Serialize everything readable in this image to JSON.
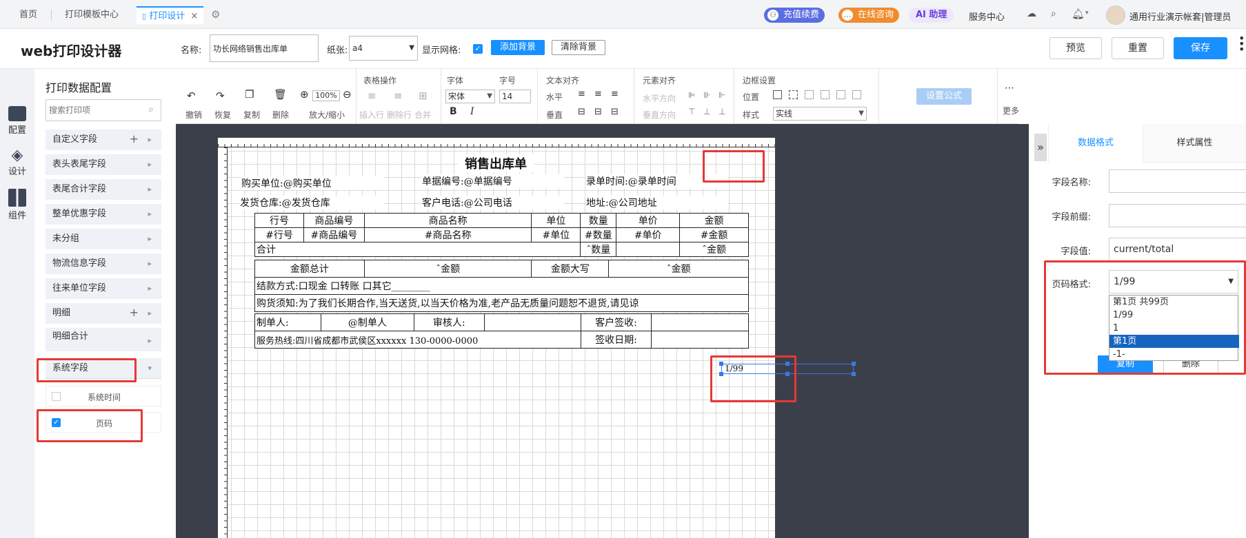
{
  "top_tabs": {
    "home": "首页",
    "template_center": "打印模板中心",
    "print_design": "打印设计",
    "close": "×"
  },
  "top_right": {
    "recharge": "充值续费",
    "consult": "在线咨询",
    "ai": "AI 助理",
    "service": "服务中心",
    "user": "通用行业演示帐套|管理员"
  },
  "header": {
    "title": "web打印设计器",
    "name_label": "名称:",
    "name_value": "功长网络销售出库单",
    "paper_label": "纸张:",
    "paper_value": "a4",
    "grid_label": "显示网格:",
    "add_bg": "添加背景",
    "clear_bg": "清除背景",
    "preview": "预览",
    "reset": "重置",
    "save": "保存"
  },
  "left_nav": {
    "config": "配置",
    "design": "设计",
    "components": "组件"
  },
  "data_config": {
    "title": "打印数据配置",
    "search_placeholder": "搜索打印项",
    "groups": [
      "自定义字段",
      "表头表尾字段",
      "表尾合计字段",
      "整单优惠字段",
      "未分组",
      "物流信息字段",
      "往来单位字段",
      "明细",
      "明细合计",
      "系统字段"
    ],
    "system_items": [
      {
        "label": "系统时间",
        "checked": false
      },
      {
        "label": "页码",
        "checked": true
      }
    ]
  },
  "toolbar": {
    "undo": "撤销",
    "redo": "恢复",
    "copy": "复制",
    "delete": "删除",
    "zoom_label": "放大/缩小",
    "zoom_value": "100%",
    "table_ops": "表格操作",
    "insert_row": "插入行",
    "delete_row": "删除行",
    "merge": "合并",
    "font": "字体",
    "font_value": "宋体",
    "font_size": "字号",
    "font_size_value": "14",
    "text_align": "文本对齐",
    "horizontal": "水平",
    "vertical": "垂直",
    "elem_align": "元素对齐",
    "h_dir": "水平方向",
    "v_dir": "垂直方向",
    "border": "边框设置",
    "position": "位置",
    "style": "样式",
    "style_value": "实线",
    "formula": "设置公式",
    "more": "更多"
  },
  "paper": {
    "title": "销售出库单",
    "fields": [
      {
        "text": "购买单位:@购买单位"
      },
      {
        "text": "单据编号:@单据编号"
      },
      {
        "text": "录单时间:@录单时间"
      },
      {
        "text": "发货仓库:@发货仓库"
      },
      {
        "text": "客户电话:@公司电话"
      },
      {
        "text": "地址:@公司地址"
      }
    ],
    "table": {
      "headers": [
        "行号",
        "商品编号",
        "商品名称",
        "单位",
        "数量",
        "单价",
        "金额"
      ],
      "row": [
        "#行号",
        "#商品编号",
        "#商品名称",
        "#单位",
        "#数量",
        "#单价",
        "#金额"
      ],
      "sum_label": "合计",
      "sum_qty": "ˆ数量",
      "sum_amt": "ˆ金额",
      "total_label": "金额总计",
      "total_value": "ˆ金额",
      "upper_label": "金额大写",
      "upper_value": "ˆ金额",
      "payment": "结款方式:口现金 口转账 口其它________",
      "notice": "购货须知:为了我们长期合作,当天送货,以当天价格为准,老产品无质量问题恕不退货,请见谅",
      "maker": "制单人:",
      "maker_value": "@制单人",
      "reviewer": "审核人:",
      "customer_sign": "客户签收:",
      "hotline": "服务热线:四川省成都市武侯区xxxxxx 130-0000-0000",
      "sign_date": "签收日期:"
    },
    "page_element": "1/99"
  },
  "right_panel": {
    "tab_data_format": "数据格式",
    "tab_style": "样式属性",
    "field_name": "字段名称:",
    "field_prefix": "字段前缀:",
    "field_value_label": "字段值:",
    "field_value": "current/total",
    "page_format_label": "页码格式:",
    "page_format_value": "1/99",
    "options": [
      "第1页 共99页",
      "1/99",
      "1",
      "第1页",
      "-1-"
    ],
    "selected_option": "第1页",
    "copy": "复制",
    "delete": "删除"
  }
}
